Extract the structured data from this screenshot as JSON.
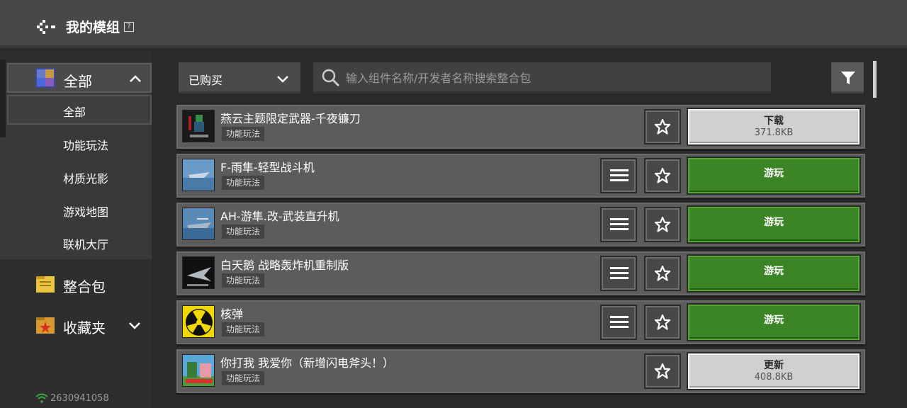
{
  "header": {
    "title": "我的模组",
    "help_glyph": "?"
  },
  "sidebar": {
    "groups": [
      {
        "label": "全部",
        "icon": "block-icon",
        "expanded": true
      },
      {
        "label": "整合包",
        "icon": "folder-yellow-icon"
      },
      {
        "label": "收藏夹",
        "icon": "folder-star-icon"
      }
    ],
    "sub_items": [
      "全部",
      "功能玩法",
      "材质光影",
      "游戏地图",
      "联机大厅"
    ],
    "network_id": "2630941058"
  },
  "toolbar": {
    "dropdown_value": "已购买",
    "search_placeholder": "输入组件名称/开发者名称搜索整合包"
  },
  "items": [
    {
      "name": "燕云主题限定武器-千夜镰刀",
      "tag": "功能玩法",
      "action": "下载",
      "size": "371.8KB",
      "has_list": false
    },
    {
      "name": "F-雨隼-轻型战斗机",
      "tag": "功能玩法",
      "action": "游玩",
      "has_list": true
    },
    {
      "name": "AH-游隼.改-武装直升机",
      "tag": "功能玩法",
      "action": "游玩",
      "has_list": true
    },
    {
      "name": "白天鹅 战略轰炸机重制版",
      "tag": "功能玩法",
      "action": "游玩",
      "has_list": true
    },
    {
      "name": "核弹",
      "tag": "功能玩法",
      "action": "游玩",
      "has_list": true
    },
    {
      "name": "你打我 我爱你（新增闪电斧头！）",
      "tag": "功能玩法",
      "action": "更新",
      "size": "408.8KB",
      "has_list": false
    }
  ],
  "colors": {
    "play_green": "#3c8527",
    "download_gray": "#d0d0d0",
    "row_bg": "#5c5c5c"
  }
}
